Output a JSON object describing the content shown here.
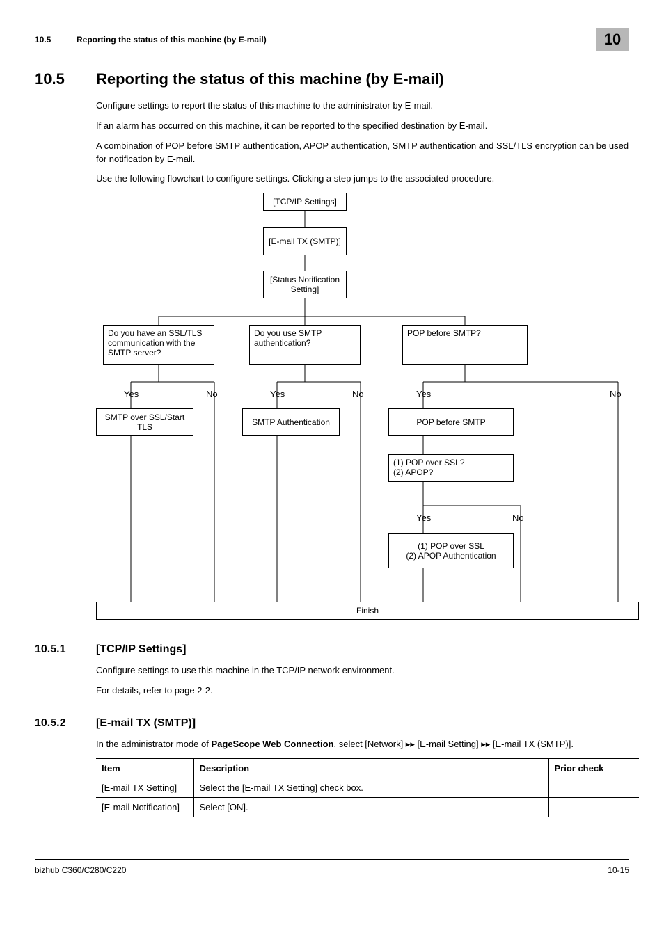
{
  "header": {
    "section_number": "10.5",
    "section_title": "Reporting the status of this machine (by E-mail)",
    "chapter_number": "10"
  },
  "h1": {
    "number": "10.5",
    "title": "Reporting the status of this machine (by E-mail)"
  },
  "intro": {
    "p1": "Configure settings to report the status of this machine to the administrator by E-mail.",
    "p2": "If an alarm has occurred on this machine, it can be reported to the specified destination by E-mail.",
    "p3": "A combination of POP before SMTP authentication, APOP authentication, SMTP authentication and SSL/TLS encryption can be used for notification by E-mail.",
    "p4": "Use the following flowchart to configure settings. Clicking a step jumps to the associated procedure."
  },
  "flow": {
    "tcpip": "[TCP/IP Settings]",
    "email_tx": "[E-mail TX (SMTP)]",
    "status_notif": "[Status Notification Setting]",
    "q_ssl": "Do you have an SSL/TLS communication with the SMTP server?",
    "q_smtp_auth": "Do you use SMTP authentication?",
    "q_pop_before": "POP before SMTP?",
    "yes": "Yes",
    "no": "No",
    "smtp_ssl": "SMTP over SSL/Start TLS",
    "smtp_auth": "SMTP Authentication",
    "pop_before": "POP before SMTP",
    "q_pop_ssl": "(1) POP over SSL?\n(2) APOP?",
    "pop_ssl": "(1) POP over SSL\n(2) APOP Authentication",
    "finish": "Finish"
  },
  "s1051": {
    "number": "10.5.1",
    "title": "[TCP/IP Settings]",
    "p1": "Configure settings to use this machine in the TCP/IP network environment.",
    "p2": "For details, refer to page 2-2."
  },
  "s1052": {
    "number": "10.5.2",
    "title": "[E-mail TX (SMTP)]",
    "p1_a": "In the administrator mode of ",
    "p1_b": "PageScope Web Connection",
    "p1_c": ", select [Network] ▸▸ [E-mail Setting] ▸▸ [E-mail TX (SMTP)].",
    "table": {
      "head": {
        "c1": "Item",
        "c2": "Description",
        "c3": "Prior check"
      },
      "rows": [
        {
          "c1": "[E-mail TX Setting]",
          "c2": "Select the [E-mail TX Setting] check box.",
          "c3": ""
        },
        {
          "c1": "[E-mail Notification]",
          "c2": "Select [ON].",
          "c3": ""
        }
      ]
    }
  },
  "footer": {
    "left": "bizhub C360/C280/C220",
    "right": "10-15"
  }
}
